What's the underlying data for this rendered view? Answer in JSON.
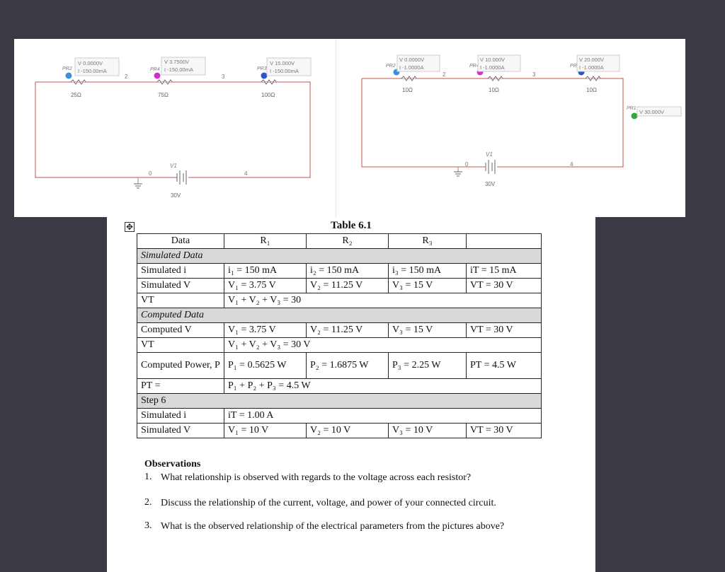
{
  "circuit_left": {
    "probes": [
      {
        "name": "PR2",
        "voltage": "V 0.0000V",
        "current": "I -150.00mA"
      },
      {
        "name": "PR4",
        "voltage": "V 3.7500V",
        "current": "I -150.00mA"
      },
      {
        "name": "PR3",
        "voltage": "V 15.000V",
        "current": "I -150.00mA"
      }
    ],
    "resistors": [
      "25Ω",
      "75Ω",
      "100Ω"
    ],
    "nodes": [
      "2",
      "3",
      "0",
      "4"
    ],
    "source_name": "V1",
    "source_value": "30V"
  },
  "circuit_right": {
    "probes": [
      {
        "name": "PR2",
        "voltage": "V 0.0000V",
        "current": "I -1.0000A"
      },
      {
        "name": "PR4",
        "voltage": "V 10.000V",
        "current": "I -1.0000A"
      },
      {
        "name": "PR3",
        "voltage": "V 20.000V",
        "current": "I -1.0000A"
      }
    ],
    "voltage_probe": {
      "name": "PR1",
      "value": "V 30.000V"
    },
    "resistors": [
      "10Ω",
      "10Ω",
      "10Ω"
    ],
    "nodes": [
      "2",
      "3",
      "0",
      "4"
    ],
    "source_name": "V1",
    "source_value": "30V"
  },
  "table": {
    "title": "Table 6.1",
    "headers": [
      "Data",
      "R₁",
      "R₂",
      "R₃",
      ""
    ],
    "rows": {
      "sim_section": "Simulated Data",
      "sim_i": [
        "Simulated i",
        "i₁ = 150 mA",
        "i₂ = 150 mA",
        "i₃ = 150 mA",
        "iT = 15 mA"
      ],
      "sim_v": [
        "Simulated V",
        "V₁ = 3.75 V",
        "V₂ = 11.25 V",
        "V₃ = 15 V",
        "VT = 30 V"
      ],
      "sim_vt": [
        "VT",
        "V₁ + V₂ + V₃ = 30"
      ],
      "comp_section": "Computed Data",
      "comp_v": [
        "Computed V",
        "V₁ = 3.75 V",
        "V₂ = 11.25 V",
        "V₃ = 15 V",
        "VT = 30 V"
      ],
      "comp_vt": [
        "VT",
        "V₁ + V₂ + V₃ = 30 V"
      ],
      "comp_p": [
        "Computed Power, P",
        "P₁ = 0.5625 W",
        "P₂ = 1.6875 W",
        "P₃ = 2.25 W",
        "PT = 4.5 W"
      ],
      "comp_pt": [
        "PT =",
        "P₁ + P₂ + P₃ = 4.5 W"
      ],
      "step_section": "Step 6",
      "step_i": [
        "Simulated i",
        "iT = 1.00 A"
      ],
      "step_v": [
        "Simulated V",
        "V₁ = 10 V",
        "V₂ = 10 V",
        "V₃ = 10 V",
        "VT = 30 V"
      ]
    }
  },
  "observations": {
    "title": "Observations",
    "items": [
      {
        "num": "1.",
        "text": "What relationship is observed with regards to the voltage across each resistor?"
      },
      {
        "num": "2.",
        "text": "Discuss the relationship of the current, voltage, and power of your connected circuit."
      },
      {
        "num": "3.",
        "text": "What is the observed relationship of the electrical parameters from the pictures above?"
      }
    ]
  },
  "colors": {
    "wire": "#c0504d",
    "probe_a": "#3b8fd9",
    "probe_b": "#cc33cc",
    "probe_c": "#2a55c8",
    "probe_v": "#2eaa3a"
  }
}
